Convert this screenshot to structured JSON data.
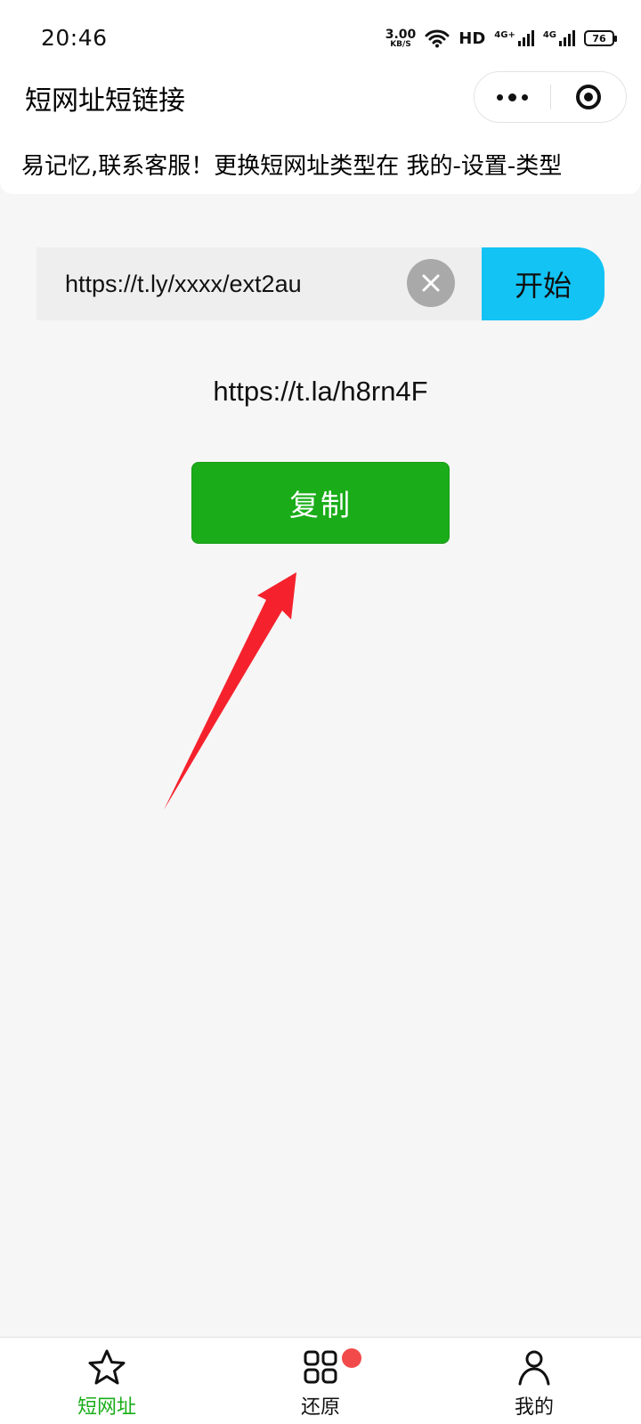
{
  "status_bar": {
    "time": "20:46",
    "net_speed": "3.00",
    "net_unit": "KB/S",
    "hd_label": "HD",
    "signal1_label": "4G+",
    "signal2_label": "4G",
    "battery": "76",
    "icons": [
      "wifi-icon",
      "signal-icon",
      "battery-icon"
    ]
  },
  "nav": {
    "title": "短网址短链接",
    "icons": [
      "more-icon",
      "target-icon"
    ]
  },
  "notice": {
    "text": "易记忆,联系客服！更换短网址类型在 我的-设置-类型"
  },
  "form": {
    "input_value": "https://t.ly/xxxx/ext2au",
    "start_label": "开始",
    "clear_icon": "close-icon"
  },
  "result": {
    "short_url": "https://t.la/h8rn4F",
    "copy_label": "复制"
  },
  "tabbar": {
    "items": [
      {
        "label": "短网址",
        "icon": "star-icon",
        "active": true
      },
      {
        "label": "还原",
        "icon": "grid-icon",
        "badge": true
      },
      {
        "label": "我的",
        "icon": "user-icon"
      }
    ]
  },
  "colors": {
    "accent_green": "#1aad19",
    "start_blue": "#12c3f4",
    "arrow_red": "#f5222d",
    "badge_red": "#f24a4a"
  }
}
